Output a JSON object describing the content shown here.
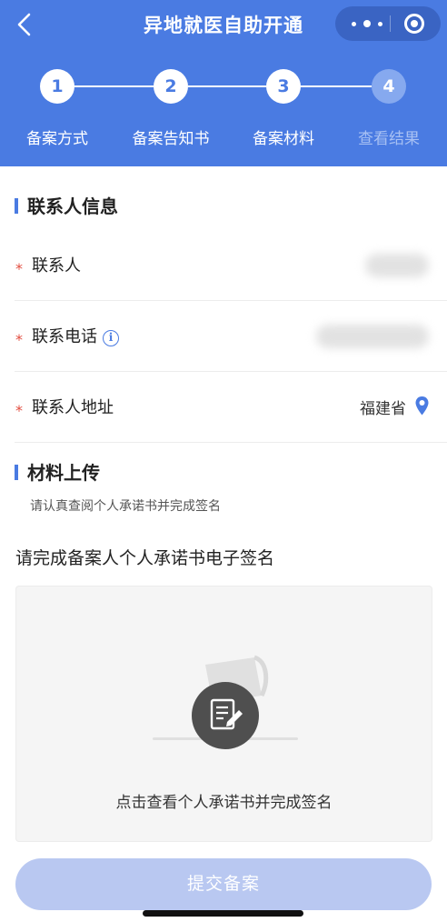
{
  "header": {
    "title": "异地就医自助开通",
    "capsule_icons": [
      "more-dots-icon",
      "target-circle-icon"
    ],
    "back_icon": "chevron-left-icon",
    "bg_color": "#4a7be2"
  },
  "steps": [
    {
      "num": "1",
      "label": "备案方式",
      "active": true
    },
    {
      "num": "2",
      "label": "备案告知书",
      "active": true
    },
    {
      "num": "3",
      "label": "备案材料",
      "active": true
    },
    {
      "num": "4",
      "label": "查看结果",
      "active": false
    }
  ],
  "contact": {
    "section_title": "联系人信息",
    "required_mark": "*",
    "name_label": "联系人",
    "phone_label": "联系电话",
    "address_label": "联系人地址",
    "address_value": "福建省",
    "info_icon_glyph": "i"
  },
  "upload": {
    "section_title": "材料上传",
    "hint": "请认真查阅个人承诺书并完成签名",
    "sign_title": "请完成备案人个人承诺书电子签名",
    "sign_action": "点击查看个人承诺书并完成签名"
  },
  "submit": {
    "label": "提交备案",
    "enabled": false
  }
}
